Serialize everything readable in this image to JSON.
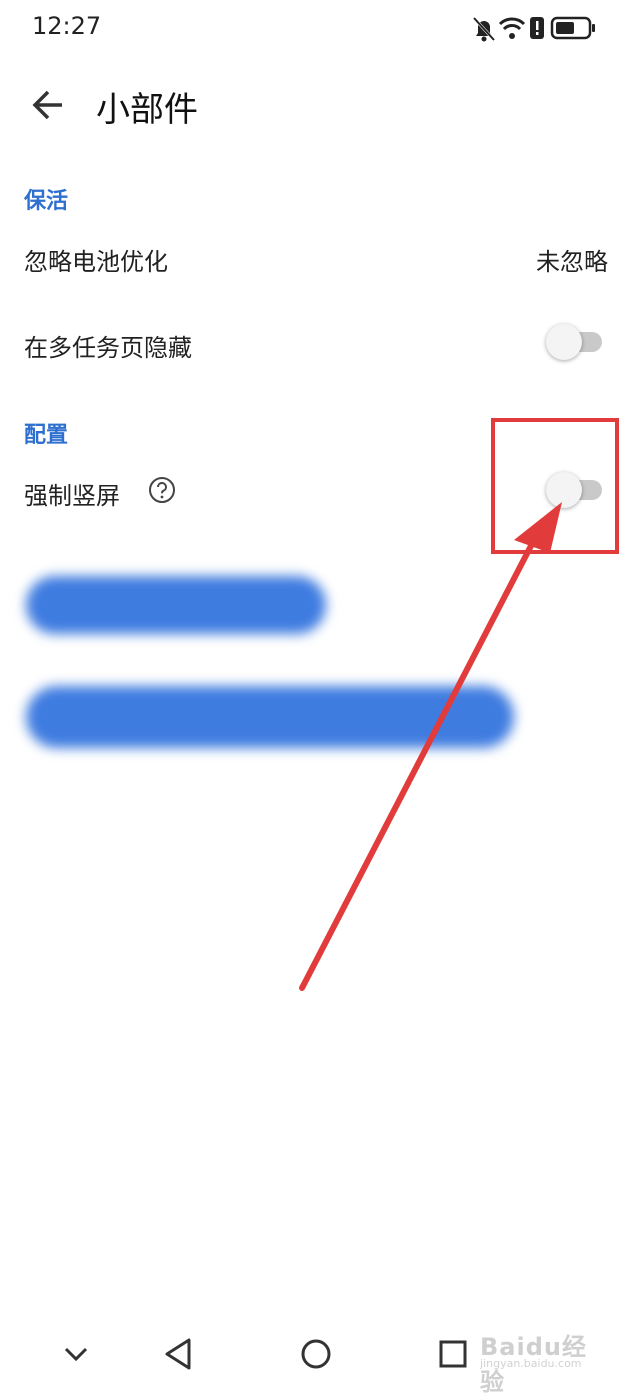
{
  "status_bar": {
    "time": "12:27",
    "icons": [
      "bell-off-icon",
      "wifi-icon",
      "battery-alert-icon",
      "battery-icon"
    ]
  },
  "app_bar": {
    "title": "小部件",
    "back_icon": "arrow-left-icon"
  },
  "sections": {
    "keep_alive": {
      "header": "保活",
      "ignore_battery_label": "忽略电池优化",
      "ignore_battery_value": "未忽略",
      "hide_recents_label": "在多任务页隐藏",
      "hide_recents_on": false
    },
    "config": {
      "header": "配置",
      "force_portrait_label": "强制竖屏",
      "force_portrait_on": false
    }
  },
  "nav_bar": {
    "icons": [
      "chevron-down-icon",
      "back-triangle-icon",
      "home-circle-icon",
      "recents-square-icon"
    ]
  },
  "watermark": {
    "text": "Baidu经验",
    "sub": "jingyan.baidu.com"
  },
  "colors": {
    "accent": "#2f6fcf",
    "annotation": "#e23b3b",
    "toggle_track": "#c9c9c9"
  }
}
